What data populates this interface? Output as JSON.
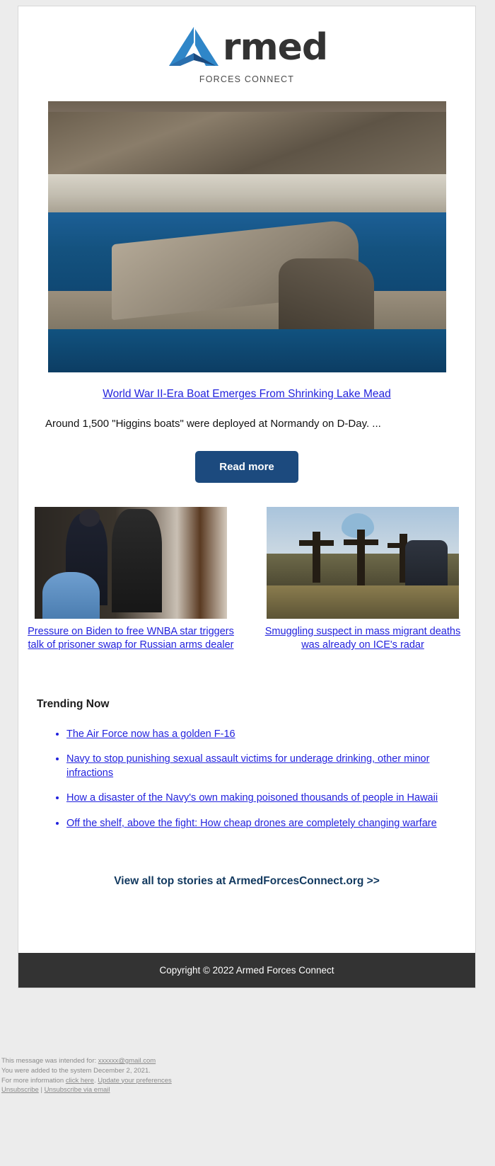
{
  "brand": {
    "logo_word": "rmed",
    "logo_tagline": "FORCES CONNECT",
    "logo_icon": "armed-forces-connect-triangle-logo",
    "accent_dark_blue": "#1c4a7e",
    "accent_light_blue": "#2f86c8",
    "link_blue": "#2222dd",
    "footer_bar": "#333333"
  },
  "hero": {
    "image_alt": "World War II-era Higgins boat emerging from the shrinking waters of Lake Mead",
    "title": "World War II-Era Boat Emerges From Shrinking Lake Mead",
    "description": "Around 1,500 \"Higgins boats\" were deployed at Normandy on D-Day. ...",
    "cta_label": "Read more"
  },
  "stories": [
    {
      "image_alt": "WNBA star escorted by a police officer in a courtroom",
      "title": "Pressure on Biden to free WNBA star triggers talk of prisoner swap for Russian arms dealer"
    },
    {
      "image_alt": "Roadside memorial with crosses, flowers and a heart balloon",
      "title": "Smuggling suspect in mass migrant deaths was already on ICE's radar"
    }
  ],
  "trending": {
    "heading": "Trending Now",
    "items": [
      "The Air Force now has a golden F-16",
      "Navy to stop punishing sexual assault victims for underage drinking, other minor infractions",
      "How a disaster of the Navy's own making poisoned thousands of people in Hawaii",
      "Off the shelf, above the fight: How cheap drones are completely changing warfare"
    ]
  },
  "view_all": {
    "label": "View all top stories at ArmedForcesConnect.org >>"
  },
  "copyright": {
    "text": "Copyright © 2022 Armed Forces Connect"
  },
  "fineprint": {
    "line1_prefix": "This message was intended for: ",
    "line1_email": "xxxxxx@gmail.com",
    "line2": "You were added to the system December 2, 2021.",
    "line3_prefix": "For more information ",
    "line3_link1": "click here",
    "line3_mid": ". ",
    "line3_link2": "Update your preferences",
    "line4_link1": "Unsubscribe",
    "line4_sep": " | ",
    "line4_link2": "Unsubscribe via email"
  }
}
